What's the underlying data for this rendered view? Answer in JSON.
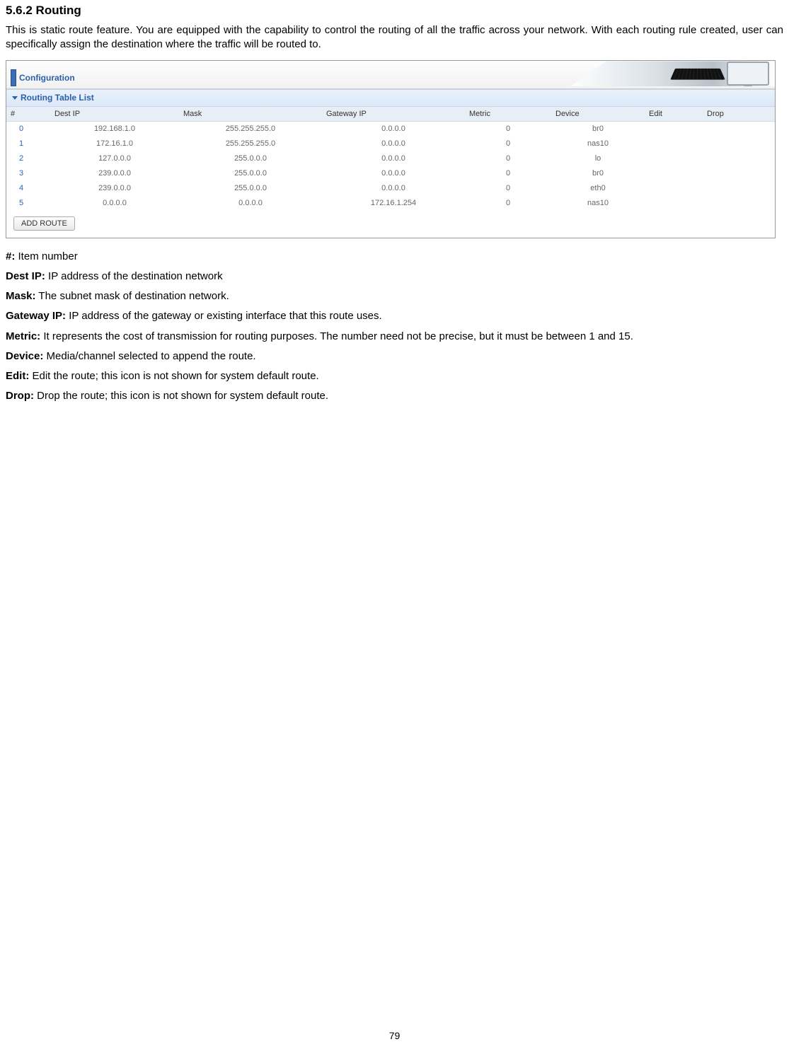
{
  "section": {
    "number": "5.6.2",
    "title": "Routing"
  },
  "intro": "This is static route feature. You are equipped with the capability to control the routing of all the traffic across your network. With each routing rule created, user can specifically assign the destination where the traffic will be routed to.",
  "screenshot": {
    "config_label": "Configuration",
    "section_label": "Routing Table List",
    "columns": [
      "#",
      "Dest IP",
      "Mask",
      "Gateway IP",
      "Metric",
      "Device",
      "Edit",
      "Drop"
    ],
    "rows": [
      {
        "n": "0",
        "dest": "192.168.1.0",
        "mask": "255.255.255.0",
        "gw": "0.0.0.0",
        "metric": "0",
        "dev": "br0"
      },
      {
        "n": "1",
        "dest": "172.16.1.0",
        "mask": "255.255.255.0",
        "gw": "0.0.0.0",
        "metric": "0",
        "dev": "nas10"
      },
      {
        "n": "2",
        "dest": "127.0.0.0",
        "mask": "255.0.0.0",
        "gw": "0.0.0.0",
        "metric": "0",
        "dev": "lo"
      },
      {
        "n": "3",
        "dest": "239.0.0.0",
        "mask": "255.0.0.0",
        "gw": "0.0.0.0",
        "metric": "0",
        "dev": "br0"
      },
      {
        "n": "4",
        "dest": "239.0.0.0",
        "mask": "255.0.0.0",
        "gw": "0.0.0.0",
        "metric": "0",
        "dev": "eth0"
      },
      {
        "n": "5",
        "dest": "0.0.0.0",
        "mask": "0.0.0.0",
        "gw": "172.16.1.254",
        "metric": "0",
        "dev": "nas10"
      }
    ],
    "button": "ADD ROUTE"
  },
  "definitions": [
    {
      "term": "#:",
      "desc": " Item number"
    },
    {
      "term": "Dest IP:",
      "desc": " IP address of the destination network"
    },
    {
      "term": "Mask:",
      "desc": " The subnet mask of destination network."
    },
    {
      "term": "Gateway IP:",
      "desc": " IP address of the gateway or existing interface that this route uses."
    },
    {
      "term": "Metric:",
      "desc": " It represents the cost of transmission for routing purposes. The number need not be precise, but it must be between 1 and 15."
    },
    {
      "term": "Device:",
      "desc": " Media/channel selected to append the route."
    },
    {
      "term": "Edit:",
      "desc": " Edit the route; this icon is not shown for system default route."
    },
    {
      "term": "Drop:",
      "desc": " Drop the route; this icon is not shown for system default route."
    }
  ],
  "page_number": "79"
}
